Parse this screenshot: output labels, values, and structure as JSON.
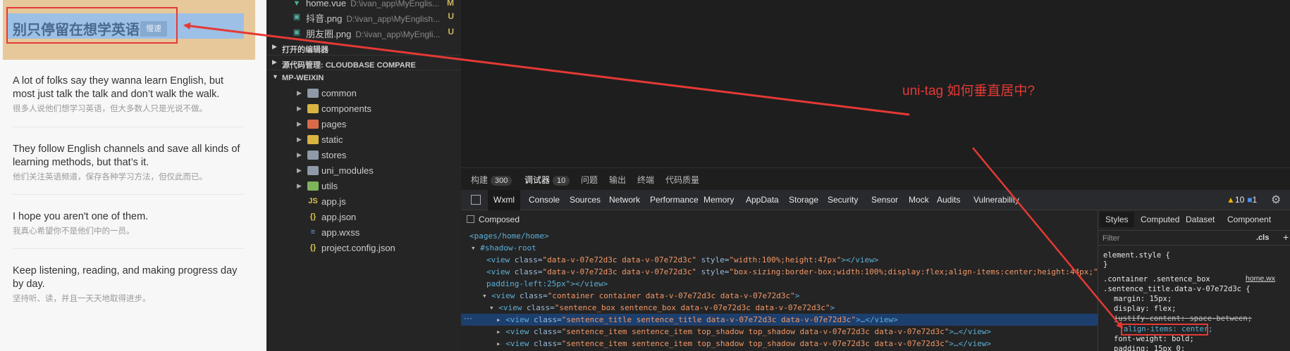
{
  "phone": {
    "hero_title": "别只停留在想学英语",
    "hero_tag": "慢速",
    "sentences": [
      {
        "en": "A lot of folks say they wanna learn English, but most just talk the talk and don’t walk the walk.",
        "zh": "很多人说他们想学习英语，但大多数人只是光说不做。"
      },
      {
        "en": "They follow English channels and save all kinds of learning methods, but that’s it.",
        "zh": "他们关注英语频道，保存各种学习方法，但仅此而已。"
      },
      {
        "en": "I hope you aren't one of them.",
        "zh": "我真心希望你不是他们中的一员。"
      },
      {
        "en": "Keep listening, reading, and making progress day by day.",
        "zh": "坚持听、读，并且一天天地取得进步。"
      }
    ]
  },
  "explorer": {
    "files": [
      {
        "icon": "vue-icon",
        "name": "home.vue",
        "path": "D:\\ivan_app\\MyEnglis...",
        "status": "M"
      },
      {
        "icon": "image-icon",
        "name": "抖音.png",
        "path": "D:\\ivan_app\\MyEnglish...",
        "status": "U"
      },
      {
        "icon": "image-icon",
        "name": "朋友圈.png",
        "path": "D:\\ivan_app\\MyEngli...",
        "status": "U"
      }
    ],
    "sections": [
      {
        "label": "打开的编辑器"
      },
      {
        "label": "源代码管理: CLOUDBASE COMPARE"
      },
      {
        "label": "MP-WEIXIN"
      }
    ],
    "tree": [
      {
        "label": "common",
        "type": "folder"
      },
      {
        "label": "components",
        "type": "folder"
      },
      {
        "label": "pages",
        "type": "folder"
      },
      {
        "label": "static",
        "type": "folder"
      },
      {
        "label": "stores",
        "type": "folder"
      },
      {
        "label": "uni_modules",
        "type": "folder"
      },
      {
        "label": "utils",
        "type": "folder"
      },
      {
        "label": "app.js",
        "type": "file"
      },
      {
        "label": "app.json",
        "type": "file"
      },
      {
        "label": "app.wxss",
        "type": "file"
      },
      {
        "label": "project.config.json",
        "type": "file"
      }
    ]
  },
  "annotation": {
    "question": "uni-tag 如何垂直居中?"
  },
  "panel": {
    "tabs": [
      {
        "label": "构建",
        "badge": "300"
      },
      {
        "label": "调试器",
        "badge": "10"
      },
      {
        "label": "问题",
        "badge": ""
      },
      {
        "label": "输出",
        "badge": ""
      },
      {
        "label": "终端",
        "badge": ""
      },
      {
        "label": "代码质量",
        "badge": ""
      }
    ]
  },
  "devtools": {
    "tabs": [
      "Wxml",
      "Console",
      "Sources",
      "Network",
      "Performance",
      "Memory",
      "AppData",
      "Storage",
      "Security",
      "Sensor",
      "Mock",
      "Audits",
      "Vulnerability"
    ],
    "warn_count": "10",
    "info_count": "1",
    "composed_label": "Composed",
    "dom_lines": [
      {
        "indent": "",
        "tag": "<pages/home/home>",
        "attrs": [],
        "text": "",
        "close": ""
      },
      {
        "indent": "▾ ",
        "tag": "#shadow-root",
        "attrs": [],
        "text": "",
        "close": ""
      },
      {
        "indent": "",
        "tag": "<view",
        "attrs": [
          [
            "class",
            "data-v-07e72d3c data-v-07e72d3c"
          ],
          [
            "style",
            "width:100%;height:47px"
          ]
        ],
        "text": "></view>",
        "close": ""
      },
      {
        "indent": "",
        "tag": "<view",
        "attrs": [
          [
            "class",
            "data-v-07e72d3c data-v-07e72d3c"
          ],
          [
            "style",
            "box-sizing:border-box;width:100%;display:flex;align-items:center;height:44px;"
          ]
        ],
        "text": "",
        "close": ""
      },
      {
        "indent": "",
        "tag": "padding-left:25px\">",
        "attrs": [],
        "text": "</view>",
        "close": ""
      },
      {
        "indent": "▾ ",
        "tag": "<view",
        "attrs": [
          [
            "class",
            "container container data-v-07e72d3c data-v-07e72d3c"
          ]
        ],
        "text": ">",
        "close": ""
      },
      {
        "indent": "▾ ",
        "tag": "<view",
        "attrs": [
          [
            "class",
            "sentence_box sentence_box data-v-07e72d3c data-v-07e72d3c"
          ]
        ],
        "text": ">",
        "close": ""
      },
      {
        "indent": "▸ ",
        "tag": "<view",
        "attrs": [
          [
            "class",
            "sentence_title sentence_title data-v-07e72d3c data-v-07e72d3c"
          ]
        ],
        "text": ">…</view>",
        "close": ""
      },
      {
        "indent": "▸ ",
        "tag": "<view",
        "attrs": [
          [
            "class",
            "sentence_item sentence_item top_shadow top_shadow data-v-07e72d3c data-v-07e72d3c"
          ]
        ],
        "text": ">…</view>",
        "close": ""
      },
      {
        "indent": "▸ ",
        "tag": "<view",
        "attrs": [
          [
            "class",
            "sentence_item sentence_item top_shadow top_shadow data-v-07e72d3c data-v-07e72d3c"
          ]
        ],
        "text": ">…</view>",
        "close": ""
      }
    ],
    "styles_tabs": [
      "Styles",
      "Computed",
      "Dataset",
      "Component"
    ],
    "filter_placeholder": "Filter",
    "cls_label": ".cls",
    "plus_label": "+",
    "style_lines": [
      "element.style {",
      "}",
      ".container .sentence_box",
      ".sentence_title.data-v-07e72d3c {",
      "margin: 15px;",
      "display: flex;",
      "justify-content: space-between;",
      "align-items: center;",
      "font-weight: bold;",
      "padding: 15px 0;"
    ],
    "style_source": "home.wx"
  },
  "colors": {
    "annotation": "#e53935",
    "selected_row": "#1c3f6e",
    "hero_bg": "#e6c89a",
    "hero_inner": "#9dc0e6"
  }
}
